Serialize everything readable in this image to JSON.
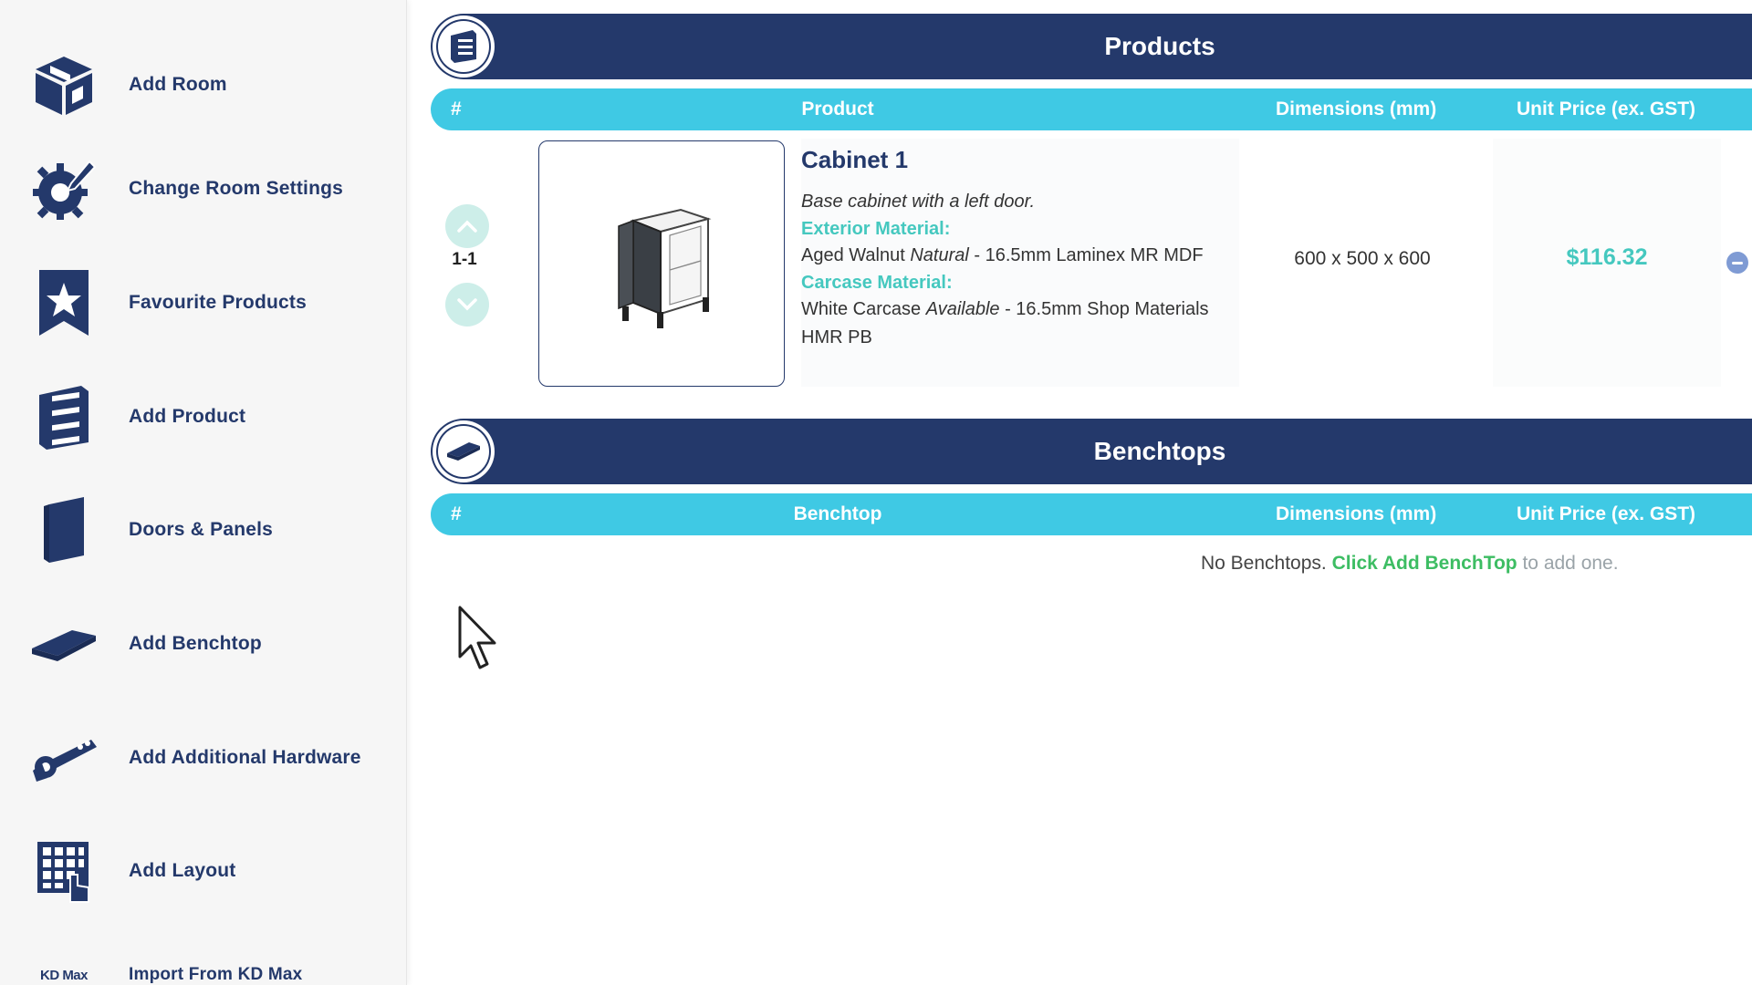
{
  "sidebar": {
    "items": [
      {
        "label": "Add Room",
        "icon": "room-box-icon"
      },
      {
        "label": "Change Room Settings",
        "icon": "gear-pencil-icon"
      },
      {
        "label": "Favourite Products",
        "icon": "bookmark-star-icon"
      },
      {
        "label": "Add Product",
        "icon": "cabinet-drawers-icon"
      },
      {
        "label": "Doors & Panels",
        "icon": "door-panel-icon"
      },
      {
        "label": "Add Benchtop",
        "icon": "benchtop-slab-icon"
      },
      {
        "label": "Add Additional Hardware",
        "icon": "hinge-hardware-icon"
      },
      {
        "label": "Add Layout",
        "icon": "grid-hand-icon"
      },
      {
        "label": "Import From KD Max",
        "icon_text": "KD Max",
        "icon": "kd-max-icon"
      }
    ]
  },
  "products": {
    "title": "Products",
    "columns": {
      "hash": "#",
      "product": "Product",
      "dimensions": "Dimensions (mm)",
      "price": "Unit Price (ex. GST)"
    },
    "rows": [
      {
        "number": "1-1",
        "name": "Cabinet 1",
        "description": "Base cabinet with a left door.",
        "exterior_label": "Exterior Material:",
        "exterior_name": "Aged Walnut",
        "exterior_finish": "Natural",
        "exterior_detail": "- 16.5mm Laminex MR MDF",
        "carcase_label": "Carcase Material:",
        "carcase_name": "White Carcase",
        "carcase_finish": "Available",
        "carcase_detail": "- 16.5mm Shop Materials HMR PB",
        "dimensions": "600 x 500 x 600",
        "price": "$116.32"
      }
    ]
  },
  "benchtops": {
    "title": "Benchtops",
    "columns": {
      "hash": "#",
      "benchtop": "Benchtop",
      "dimensions": "Dimensions (mm)",
      "price": "Unit Price (ex. GST)"
    },
    "empty_prefix": "No Benchtops.",
    "empty_link": "Click Add BenchTop",
    "empty_suffix": "to add one."
  },
  "colors": {
    "navy": "#24396b",
    "cyan": "#3fc9e4",
    "teal": "#45c8bf",
    "green": "#3dbd63"
  }
}
